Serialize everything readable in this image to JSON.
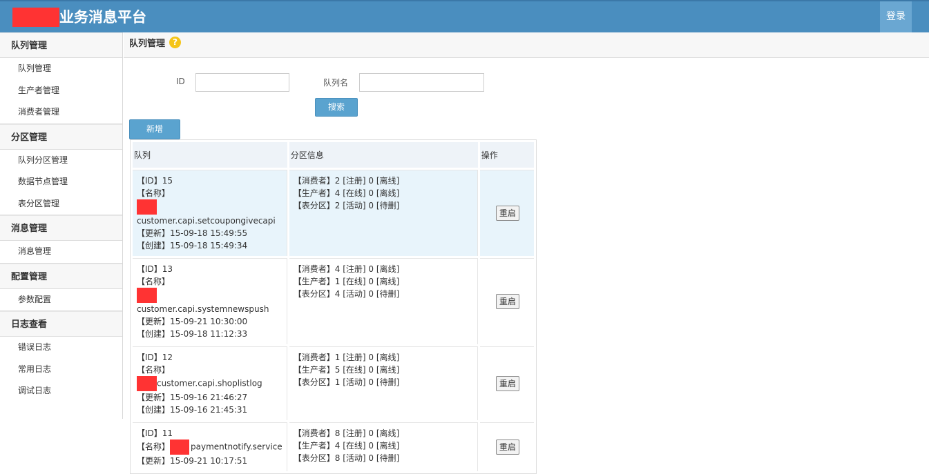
{
  "header": {
    "title": "业务消息平台",
    "login_label": "登录"
  },
  "sidebar": {
    "groups": [
      {
        "title": "队列管理",
        "items": [
          "队列管理",
          "生产者管理",
          "消费者管理"
        ]
      },
      {
        "title": "分区管理",
        "items": [
          "队列分区管理",
          "数据节点管理",
          "表分区管理"
        ]
      },
      {
        "title": "消息管理",
        "items": [
          "消息管理"
        ]
      },
      {
        "title": "配置管理",
        "items": [
          "参数配置"
        ]
      },
      {
        "title": "日志查看",
        "items": [
          "错误日志",
          "常用日志",
          "调试日志"
        ]
      }
    ]
  },
  "main": {
    "page_title": "队列管理",
    "help_icon": "?",
    "filters": {
      "id_label": "ID",
      "id_value": "",
      "name_label": "队列名",
      "name_value": ""
    },
    "search_label": "搜索",
    "add_label": "新增",
    "table": {
      "headers": [
        "队列",
        "分区信息",
        "操作"
      ],
      "rows": [
        {
          "id": "【ID】15",
          "name_label": "【名称】",
          "name": "customer.capi.setcoupongivecapi",
          "updated": "【更新】15-09-18 15:49:55",
          "created": "【创建】15-09-18 15:49:34",
          "consumers": "【消费者】2 [注册]  0 [离线]",
          "producers": "【生产者】4 [在线]  0 [离线]",
          "partitions": "【表分区】2 [活动]  0 [待删]",
          "action": "重启"
        },
        {
          "id": "【ID】13",
          "name_label": "【名称】",
          "name": "customer.capi.systemnewspush",
          "updated": "【更新】15-09-21 10:30:00",
          "created": "【创建】15-09-18 11:12:33",
          "consumers": "【消费者】4 [注册]  0 [离线]",
          "producers": "【生产者】1 [在线]  0 [离线]",
          "partitions": "【表分区】4 [活动]  0 [待删]",
          "action": "重启"
        },
        {
          "id": "【ID】12",
          "name_label": "【名称】",
          "name": "customer.capi.shoplistlog",
          "updated": "【更新】15-09-16 21:46:27",
          "created": "【创建】15-09-16 21:45:31",
          "consumers": "【消费者】1 [注册]  0 [离线]",
          "producers": "【生产者】5 [在线]  0 [离线]",
          "partitions": "【表分区】1 [活动]  0 [待删]",
          "action": "重启"
        },
        {
          "id": "【ID】11",
          "name_label": "【名称】",
          "name": "paymentnotify.service",
          "updated": "【更新】15-09-21 10:17:51",
          "created": "",
          "consumers": "【消费者】8 [注册]  0 [离线]",
          "producers": "【生产者】4 [在线]  0 [离线]",
          "partitions": "【表分区】8 [活动]  0 [待删]",
          "action": "重启"
        }
      ]
    }
  }
}
